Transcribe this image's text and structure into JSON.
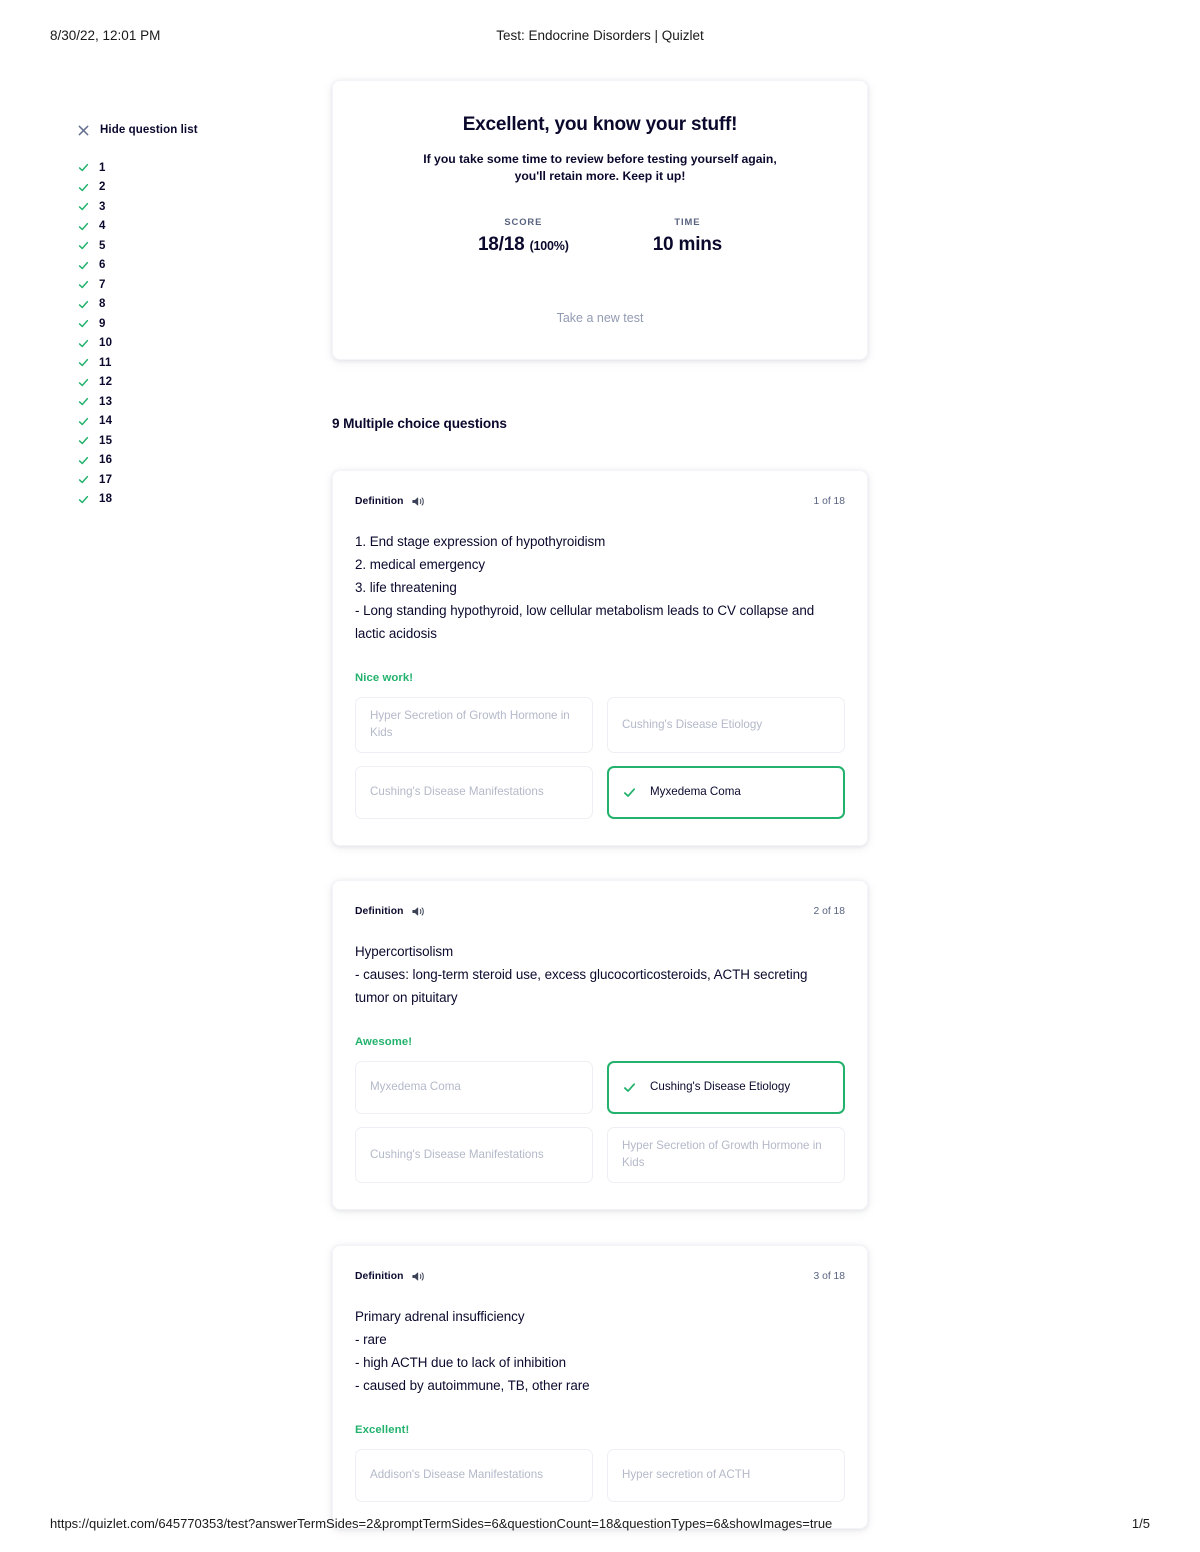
{
  "print": {
    "date": "8/30/22, 12:01 PM",
    "title": "Test: Endocrine Disorders | Quizlet",
    "url": "https://quizlet.com/645770353/test?answerTermSides=2&promptTermSides=6&questionCount=18&questionTypes=6&showImages=true",
    "page": "1/5"
  },
  "sidebar": {
    "hide_label": "Hide question list",
    "close_icon": "close-icon",
    "items": [
      {
        "number": "1",
        "status_icon": "check-icon"
      },
      {
        "number": "2",
        "status_icon": "check-icon"
      },
      {
        "number": "3",
        "status_icon": "check-icon"
      },
      {
        "number": "4",
        "status_icon": "check-icon"
      },
      {
        "number": "5",
        "status_icon": "check-icon"
      },
      {
        "number": "6",
        "status_icon": "check-icon"
      },
      {
        "number": "7",
        "status_icon": "check-icon"
      },
      {
        "number": "8",
        "status_icon": "check-icon"
      },
      {
        "number": "9",
        "status_icon": "check-icon"
      },
      {
        "number": "10",
        "status_icon": "check-icon"
      },
      {
        "number": "11",
        "status_icon": "check-icon"
      },
      {
        "number": "12",
        "status_icon": "check-icon"
      },
      {
        "number": "13",
        "status_icon": "check-icon"
      },
      {
        "number": "14",
        "status_icon": "check-icon"
      },
      {
        "number": "15",
        "status_icon": "check-icon"
      },
      {
        "number": "16",
        "status_icon": "check-icon"
      },
      {
        "number": "17",
        "status_icon": "check-icon"
      },
      {
        "number": "18",
        "status_icon": "check-icon"
      }
    ]
  },
  "result": {
    "title": "Excellent, you know your stuff!",
    "subtitle": "If you take some time to review before testing yourself again, you'll retain more. Keep it up!",
    "score_label": "SCORE",
    "score_value": "18/18",
    "score_percent": "(100%)",
    "time_label": "TIME",
    "time_value": "10 mins",
    "take_new_test": "Take a new test"
  },
  "section": {
    "heading": "9 Multiple choice questions"
  },
  "colors": {
    "accent_green": "#23b26d",
    "text_dark": "#0a092d",
    "text_muted": "#586380",
    "option_placeholder": "#b4b9c9",
    "card_border": "#edeff4"
  },
  "questions": [
    {
      "kind": "Definition",
      "speaker_icon": "speaker-icon",
      "count": "1 of 18",
      "prompt": "1. End stage expression of hypothyroidism\n2. medical emergency\n3. life threatening\n- Long standing hypothyroid, low cellular metabolism leads to CV collapse and lactic acidosis",
      "feedback": "Nice work!",
      "options": [
        {
          "text": "Hyper Secretion of Growth Hormone in Kids",
          "correct": false
        },
        {
          "text": "Cushing's Disease Etiology",
          "correct": false
        },
        {
          "text": "Cushing's Disease Manifestations",
          "correct": false
        },
        {
          "text": "Myxedema Coma",
          "correct": true
        }
      ]
    },
    {
      "kind": "Definition",
      "speaker_icon": "speaker-icon",
      "count": "2 of 18",
      "prompt": "Hypercortisolism\n- causes: long-term steroid use, excess glucocorticosteroids, ACTH secreting tumor on pituitary",
      "feedback": "Awesome!",
      "options": [
        {
          "text": "Myxedema Coma",
          "correct": false
        },
        {
          "text": "Cushing's Disease Etiology",
          "correct": true
        },
        {
          "text": "Cushing's Disease Manifestations",
          "correct": false
        },
        {
          "text": "Hyper Secretion of Growth Hormone in Kids",
          "correct": false
        }
      ]
    },
    {
      "kind": "Definition",
      "speaker_icon": "speaker-icon",
      "count": "3 of 18",
      "prompt": "Primary adrenal insufficiency\n- rare\n- high ACTH due to lack of inhibition\n- caused by autoimmune, TB, other rare",
      "feedback": "Excellent!",
      "options": [
        {
          "text": "Addison's Disease Manifestations",
          "correct": false
        },
        {
          "text": "Hyper secretion of ACTH",
          "correct": false
        }
      ]
    }
  ]
}
